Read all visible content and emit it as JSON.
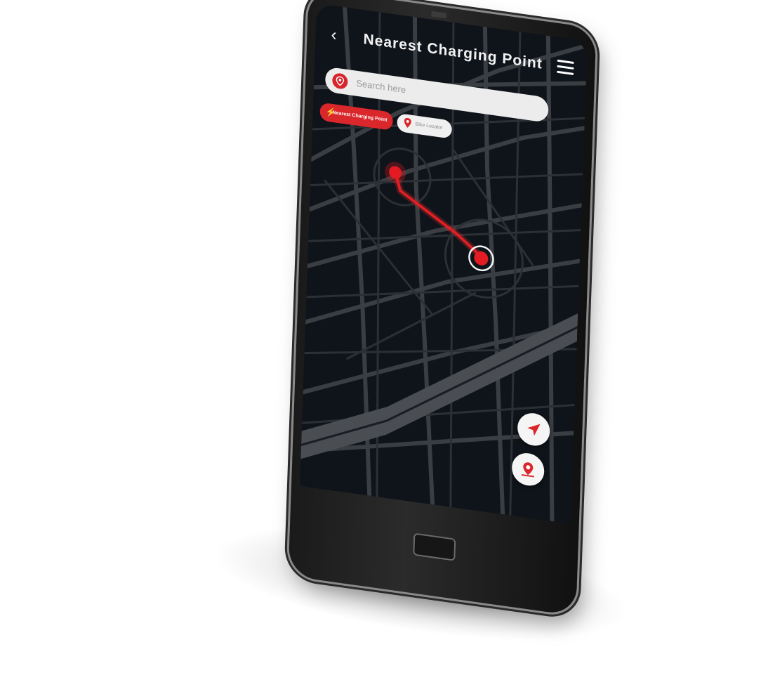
{
  "header": {
    "title": "Nearest Charging Point"
  },
  "search": {
    "placeholder": "Search here"
  },
  "chips": [
    {
      "label": "Nearest Charging Point",
      "active": true,
      "icon": "bolt-icon"
    },
    {
      "label": "Bike Locator",
      "active": false,
      "icon": "map-pin-icon"
    }
  ],
  "colors": {
    "accent": "#d9272c",
    "map_bg": "#0f141b",
    "road": "#3a3d42",
    "river": "#4a4d52"
  },
  "fabs": [
    {
      "icon": "navigation-arrow-icon"
    },
    {
      "icon": "location-marker-icon"
    }
  ]
}
